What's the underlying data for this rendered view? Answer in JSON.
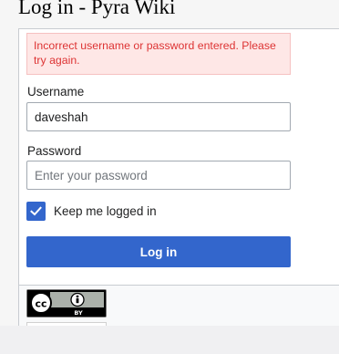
{
  "page": {
    "title": "Log in - Pyra Wiki"
  },
  "login_form": {
    "error_message": "Incorrect username or password entered. Please try again.",
    "username_label": "Username",
    "username_value": "daveshah",
    "password_label": "Password",
    "password_placeholder": "Enter your password",
    "remember_label": "Keep me logged in",
    "remember_checked": true,
    "submit_label": "Log in"
  },
  "footer": {
    "license_badge_text": "BY"
  },
  "colors": {
    "accent": "#3366cc",
    "error_text": "#d33333",
    "error_background": "#fee7e6"
  }
}
